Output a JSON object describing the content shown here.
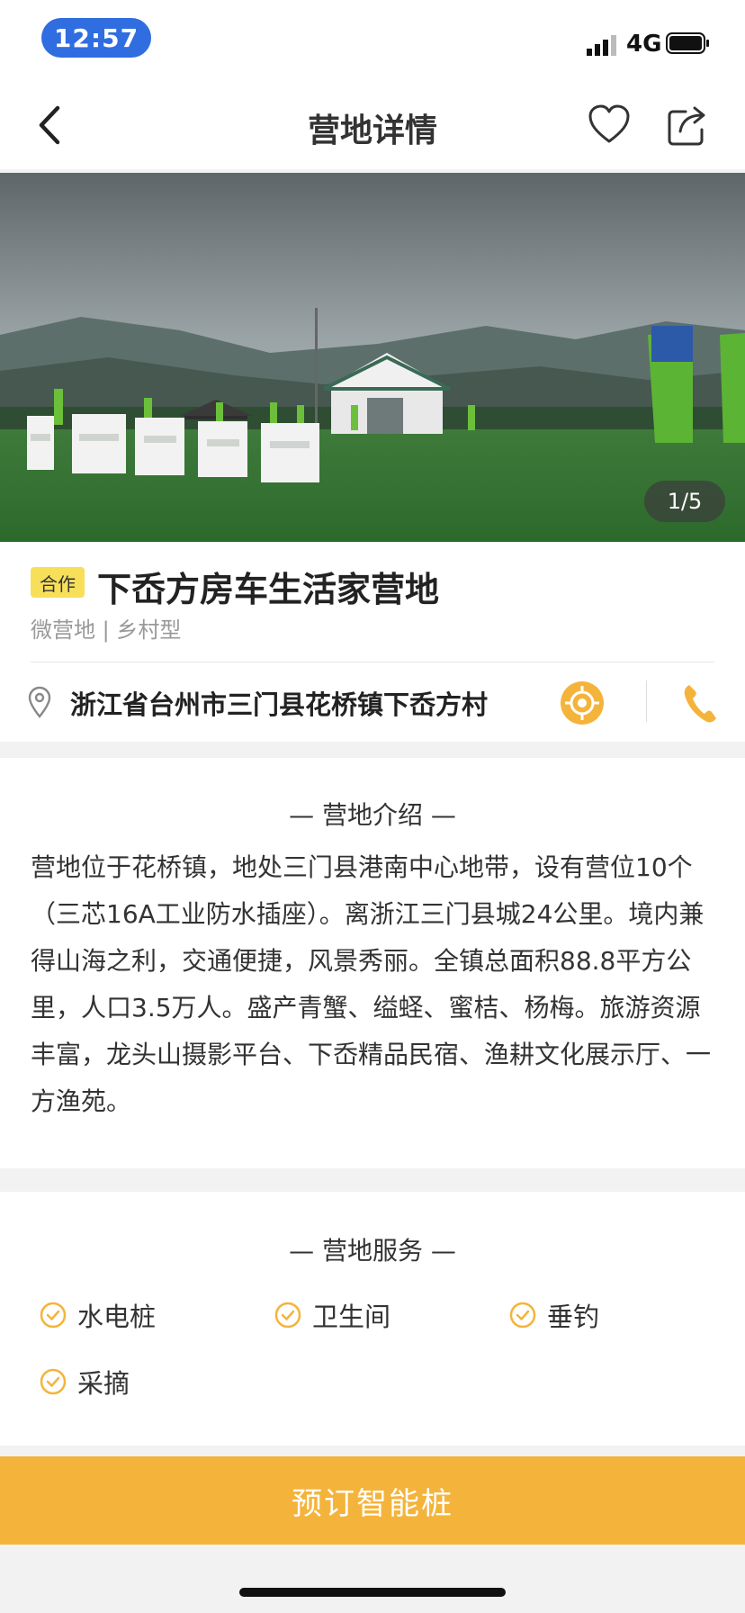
{
  "status_bar": {
    "time": "12:57",
    "network": "4G"
  },
  "nav": {
    "title": "营地详情"
  },
  "gallery": {
    "counter": "1/5"
  },
  "camp": {
    "badge": "合作",
    "name": "下岙方房车生活家营地",
    "subtitle": "微营地 | 乡村型",
    "address": "浙江省台州市三门县花桥镇下岙方村"
  },
  "intro": {
    "title": "—    营地介绍    —",
    "text": "营地位于花桥镇，地处三门县港南中心地带，设有营位10个（三芯16A工业防水插座）。离浙江三门县城24公里。境内兼得山海之利，交通便捷，风景秀丽。全镇总面积88.8平方公里，人口3.5万人。盛产青蟹、缢蛏、蜜桔、杨梅。旅游资源丰富，龙头山摄影平台、下岙精品民宿、渔耕文化展示厅、一方渔苑。"
  },
  "services": {
    "title": "—    营地服务    —",
    "items": [
      "水电桩",
      "卫生间",
      "垂钓",
      "采摘"
    ]
  },
  "book_button": {
    "label": "预订智能桩"
  },
  "colors": {
    "accent": "#f4b43b",
    "badge": "#f7df5a",
    "status_pill": "#2f6de0"
  },
  "icons": [
    "back-icon",
    "heart-icon",
    "share-icon",
    "location-pin-icon",
    "locate-icon",
    "phone-icon",
    "check-circle-icon"
  ]
}
